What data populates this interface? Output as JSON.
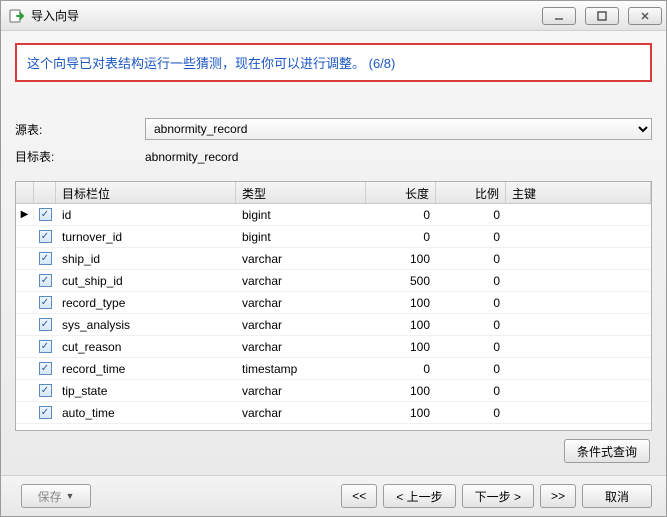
{
  "window": {
    "title": "导入向导"
  },
  "banner": {
    "text": "这个向导已对表结构运行一些猜测，现在你可以进行调整。 (6/8)"
  },
  "source": {
    "label": "源表:",
    "selected": "abnormity_record"
  },
  "target": {
    "label": "目标表:",
    "value": "abnormity_record"
  },
  "grid": {
    "headers": {
      "field": "目标栏位",
      "type": "类型",
      "length": "长度",
      "scale": "比例",
      "pk": "主键"
    },
    "rows": [
      {
        "current": true,
        "checked": true,
        "name": "id",
        "type": "bigint",
        "length": 0,
        "scale": 0
      },
      {
        "current": false,
        "checked": true,
        "name": "turnover_id",
        "type": "bigint",
        "length": 0,
        "scale": 0
      },
      {
        "current": false,
        "checked": true,
        "name": "ship_id",
        "type": "varchar",
        "length": 100,
        "scale": 0
      },
      {
        "current": false,
        "checked": true,
        "name": "cut_ship_id",
        "type": "varchar",
        "length": 500,
        "scale": 0
      },
      {
        "current": false,
        "checked": true,
        "name": "record_type",
        "type": "varchar",
        "length": 100,
        "scale": 0
      },
      {
        "current": false,
        "checked": true,
        "name": "sys_analysis",
        "type": "varchar",
        "length": 100,
        "scale": 0
      },
      {
        "current": false,
        "checked": true,
        "name": "cut_reason",
        "type": "varchar",
        "length": 100,
        "scale": 0
      },
      {
        "current": false,
        "checked": true,
        "name": "record_time",
        "type": "timestamp",
        "length": 0,
        "scale": 0
      },
      {
        "current": false,
        "checked": true,
        "name": "tip_state",
        "type": "varchar",
        "length": 100,
        "scale": 0
      },
      {
        "current": false,
        "checked": true,
        "name": "auto_time",
        "type": "varchar",
        "length": 100,
        "scale": 0
      }
    ]
  },
  "buttons": {
    "conditional_query": "条件式查询",
    "save": "保存",
    "first": "<<",
    "prev": "< 上一步",
    "next": "下一步 >",
    "last": ">>",
    "cancel": "取消"
  }
}
